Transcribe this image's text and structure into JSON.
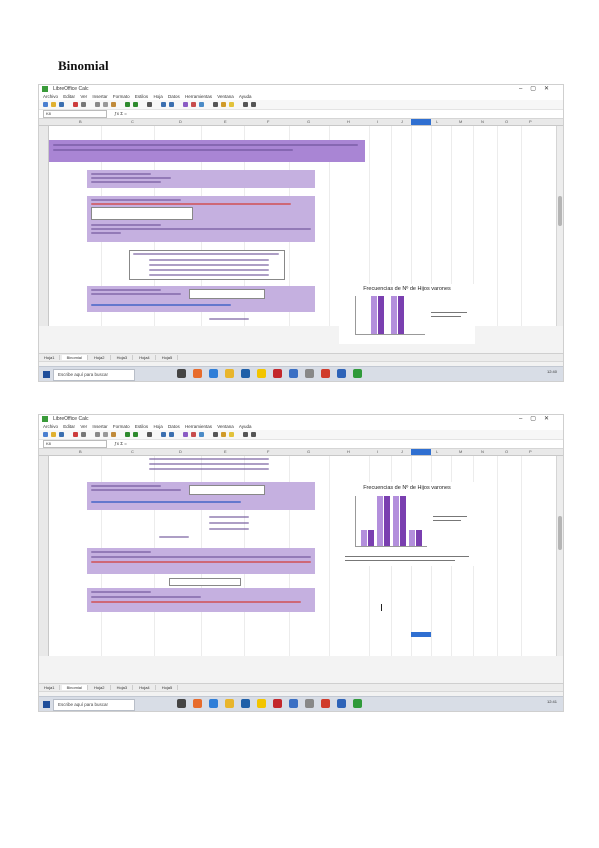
{
  "page": {
    "title": "Binomial"
  },
  "screens": [
    {
      "window_title": "LibreOffice Calc",
      "menu": [
        "Archivo",
        "Editar",
        "Ver",
        "Insertar",
        "Formato",
        "Estilos",
        "Hoja",
        "Datos",
        "Herramientas",
        "Ventana",
        "Ayuda"
      ],
      "name_box": "K8",
      "sheet_tabs": [
        "Hoja1",
        "Binomial",
        "Hoja2",
        "Hoja3",
        "Hoja4",
        "Hoja5"
      ],
      "active_tab": 1,
      "chart_title": "Frecuencias de Nº de Hijos varones",
      "chart_values": [
        0.0,
        0.75,
        0.75,
        0.0
      ],
      "search_placeholder": "Escribe aquí para buscar",
      "clock": "12:40"
    },
    {
      "window_title": "LibreOffice Calc",
      "menu": [
        "Archivo",
        "Editar",
        "Ver",
        "Insertar",
        "Formato",
        "Estilos",
        "Hoja",
        "Datos",
        "Herramientas",
        "Ventana",
        "Ayuda"
      ],
      "name_box": "K8",
      "sheet_tabs": [
        "Hoja1",
        "Binomial",
        "Hoja2",
        "Hoja3",
        "Hoja4",
        "Hoja5"
      ],
      "active_tab": 1,
      "chart_title": "Frecuencias de Nº de Hijos varones",
      "chart_values": [
        0.25,
        0.75,
        0.75,
        0.25
      ],
      "search_placeholder": "Escribe aquí para buscar",
      "clock": "12:41"
    }
  ]
}
